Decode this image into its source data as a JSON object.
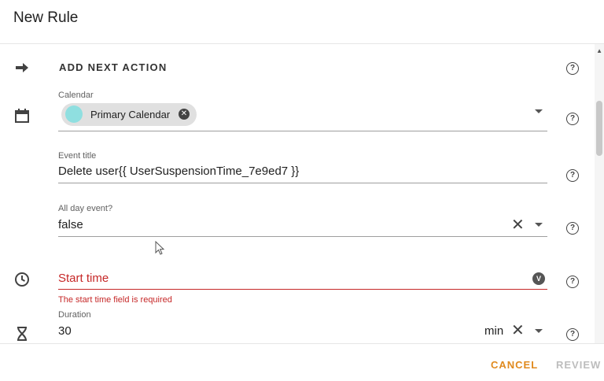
{
  "dialog": {
    "title": "New Rule"
  },
  "action": {
    "label": "ADD NEXT ACTION"
  },
  "calendar": {
    "label": "Calendar",
    "chip_label": "Primary Calendar",
    "chip_color": "#8fdfe0"
  },
  "event_title": {
    "label": "Event title",
    "value": "Delete user{{ UserSuspensionTime_7e9ed7 }}"
  },
  "all_day": {
    "label": "All day event?",
    "value": "false"
  },
  "start_time": {
    "label": "Start time",
    "error": "The start time field is required",
    "badge": "V"
  },
  "duration": {
    "label": "Duration",
    "value": "30",
    "unit": "min"
  },
  "help": {
    "glyph": "?"
  },
  "footer": {
    "cancel_label": "CANCEL",
    "review_label": "REVIEW"
  },
  "colors": {
    "accent": "#e08a1e",
    "error": "#c62828"
  }
}
